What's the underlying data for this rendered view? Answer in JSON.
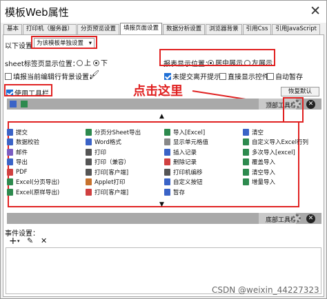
{
  "window": {
    "title": "模板Web属性",
    "close": "✕"
  },
  "tabs": [
    "基本",
    "打印机（服务器）",
    "分页预览设置",
    "填报页面设置",
    "数据分析设置",
    "浏览器背景",
    "引用Css",
    "引用JavaScript"
  ],
  "settings": {
    "scope_label": "以下设置",
    "scope_value": "为该模板单独设置",
    "sheet_pos_label": "sheet标签页显示位置：",
    "sheet_opt_top": "上",
    "sheet_opt_bottom": "下",
    "report_pos_label": "报表显示位置：",
    "report_opt_center": "居中展示",
    "report_opt_left": "左展示",
    "bg_label": "填报当前编辑行背景设置：",
    "unsubmitted_label": "未提交离开提示",
    "direct_label": "直接显示控件",
    "autosave_label": "自动暂存",
    "toolbar_label": "使用工具栏",
    "restore_label": "恢复默认"
  },
  "annotation": {
    "text": "点击这里",
    "color": "#e02020"
  },
  "toolbar": {
    "top_label": "顶部工具栏",
    "bottom_label": "底部工具栏",
    "up_arrow": "▲",
    "down_arrow": "▼"
  },
  "items": [
    {
      "label": "提交",
      "icon": "submit-icon",
      "color": "#3a63c7"
    },
    {
      "label": "分页分Sheet导出",
      "icon": "export-sheet-icon",
      "color": "#2d8a4e"
    },
    {
      "label": "导入[Excel]",
      "icon": "import-excel-icon",
      "color": "#2d8a4e"
    },
    {
      "label": "清空",
      "icon": "clear-icon",
      "color": "#3a63c7"
    },
    {
      "label": "数据校验",
      "icon": "verify-icon",
      "color": "#3a63c7"
    },
    {
      "label": "Word格式",
      "icon": "word-icon",
      "color": "#3a63c7"
    },
    {
      "label": "显示单元格值",
      "icon": "cell-value-icon",
      "color": "#888888"
    },
    {
      "label": "自定义导入Excel行列",
      "icon": "custom-import-icon",
      "color": "#2d8a4e"
    },
    {
      "label": "邮件",
      "icon": "mail-icon",
      "color": "#7a5cc2"
    },
    {
      "label": "打印",
      "icon": "print-icon",
      "color": "#555555"
    },
    {
      "label": "插入记录",
      "icon": "insert-record-icon",
      "color": "#3a63c7"
    },
    {
      "label": "多次导入[excel]",
      "icon": "multi-import-icon",
      "color": "#2d8a4e"
    },
    {
      "label": "导出",
      "icon": "export-icon",
      "color": "#3a63c7"
    },
    {
      "label": "打印（兼容）",
      "icon": "print-compat-icon",
      "color": "#555555"
    },
    {
      "label": "删除记录",
      "icon": "delete-record-icon",
      "color": "#d04040"
    },
    {
      "label": "覆盖导入",
      "icon": "overwrite-import-icon",
      "color": "#2d8a4e"
    },
    {
      "label": "PDF",
      "icon": "pdf-icon",
      "color": "#d04040"
    },
    {
      "label": "打印[客户端]",
      "icon": "print-client-icon",
      "color": "#555555"
    },
    {
      "label": "打印机编移",
      "icon": "printer-offset-icon",
      "color": "#555555"
    },
    {
      "label": "清空导入",
      "icon": "clear-import-icon",
      "color": "#2d8a4e"
    },
    {
      "label": "Excel(分页导出)",
      "icon": "excel-page-icon",
      "color": "#2d8a4e"
    },
    {
      "label": "Applet打印",
      "icon": "applet-print-icon",
      "color": "#c7722d"
    },
    {
      "label": "自定义按钮",
      "icon": "custom-button-icon",
      "color": "#3a63c7"
    },
    {
      "label": "增量导入",
      "icon": "incremental-import-icon",
      "color": "#2d8a4e"
    },
    {
      "label": "Excel(原样导出)",
      "icon": "excel-original-icon",
      "color": "#2d8a4e"
    },
    {
      "label": "打印[客户端]",
      "icon": "print-client-icon-2",
      "color": "#d04040"
    },
    {
      "label": "暂存",
      "icon": "temp-save-icon",
      "color": "#3a63c7"
    }
  ],
  "events": {
    "label": "事件设置：",
    "add": "+",
    "edit": "✎",
    "delete": "✕"
  },
  "watermark": "CSDN @weixin_44227323"
}
